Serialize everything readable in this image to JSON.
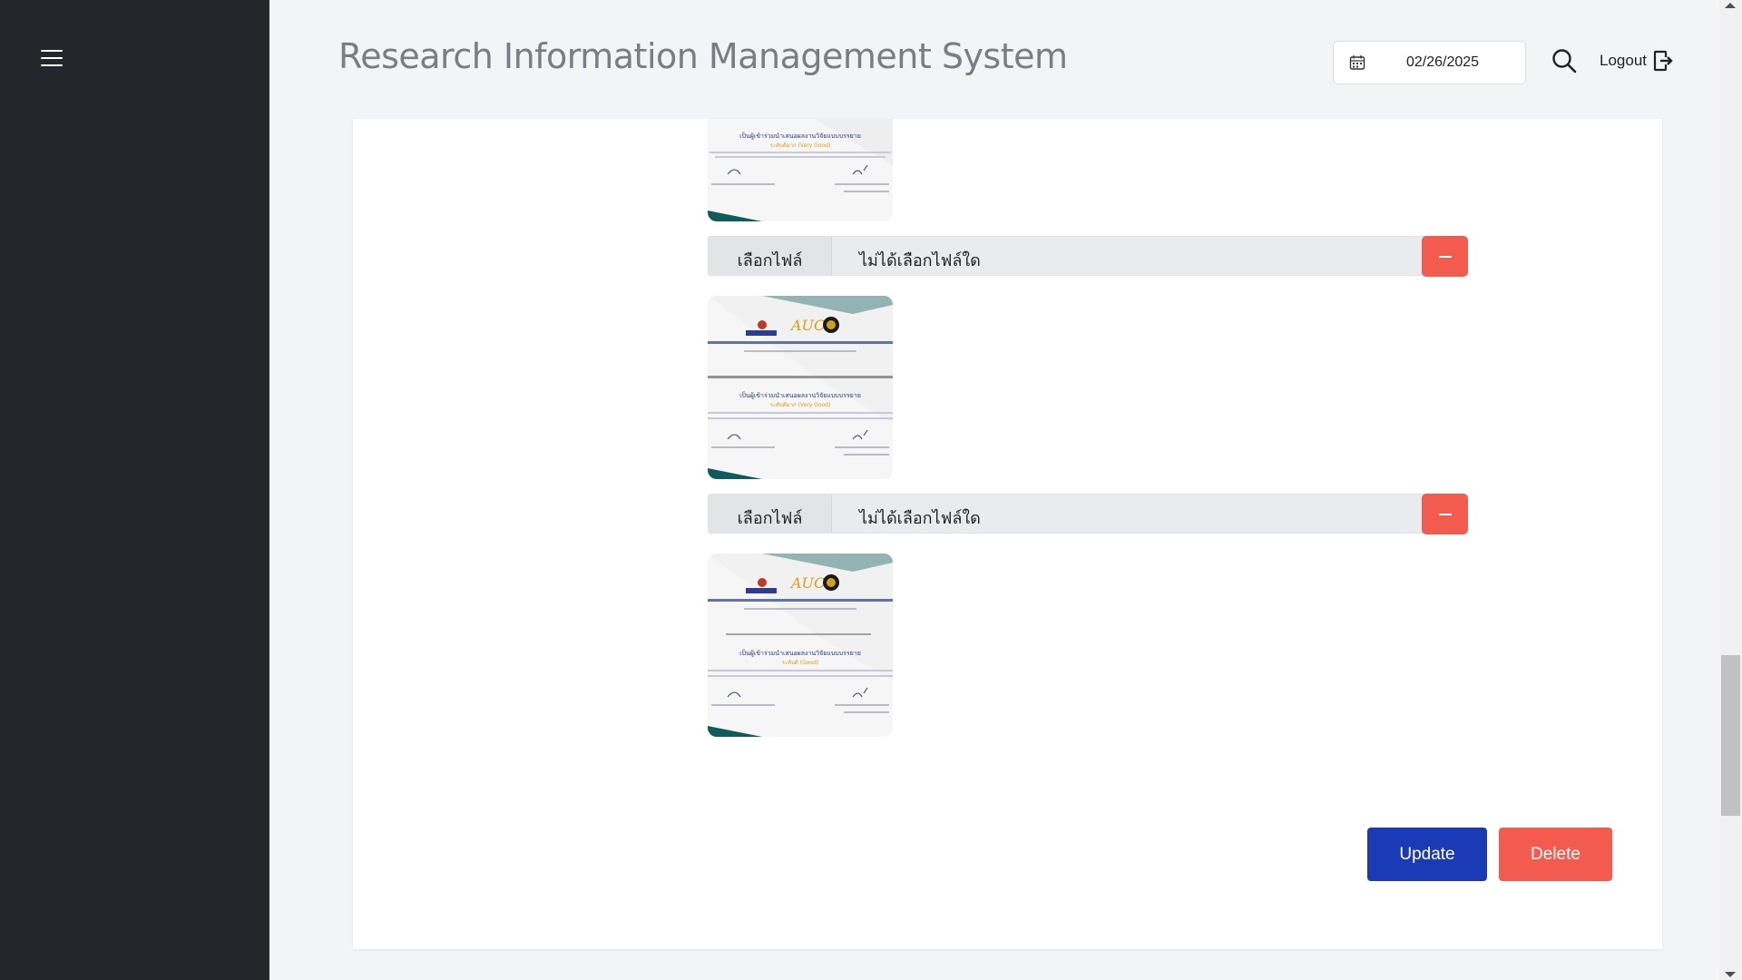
{
  "header": {
    "title": "Research Information Management System",
    "date_value": "02/26/2025",
    "logout_label": "Logout"
  },
  "icons": {
    "menu": "hamburger-menu-icon",
    "calendar": "calendar-icon",
    "search": "search-icon",
    "logout": "logout-icon",
    "remove": "minus-icon"
  },
  "files": [
    {
      "button_label": "เลือกไฟล์",
      "status_text": "ไม่ได้เลือกไฟล์ใด"
    },
    {
      "button_label": "เลือกไฟล์",
      "status_text": "ไม่ได้เลือกไฟล์ใด"
    }
  ],
  "certificates": [
    {
      "award": "ระดับดีมาก (Very Good)",
      "heading": "เป็นผู้เข้าร่วมนำเสนอผลงานวิจัยแบบบรรยาย"
    },
    {
      "award": "ระดับดีมาก (Very Good)",
      "heading": "เป็นผู้เข้าร่วมนำเสนอผลงานวิจัยแบบบรรยาย",
      "logo_text": "AUC"
    },
    {
      "award": "ระดับดี (Good)",
      "heading": "เป็นผู้เข้าร่วมนำเสนอผลงานวิจัยแบบบรรยาย",
      "logo_text": "AUC"
    }
  ],
  "actions": {
    "update_label": "Update",
    "delete_label": "Delete"
  },
  "colors": {
    "sidebar": "#25262b",
    "primary": "#1a3bb5",
    "danger": "#f35b4f",
    "accent_teal": "#0d5c5a"
  }
}
